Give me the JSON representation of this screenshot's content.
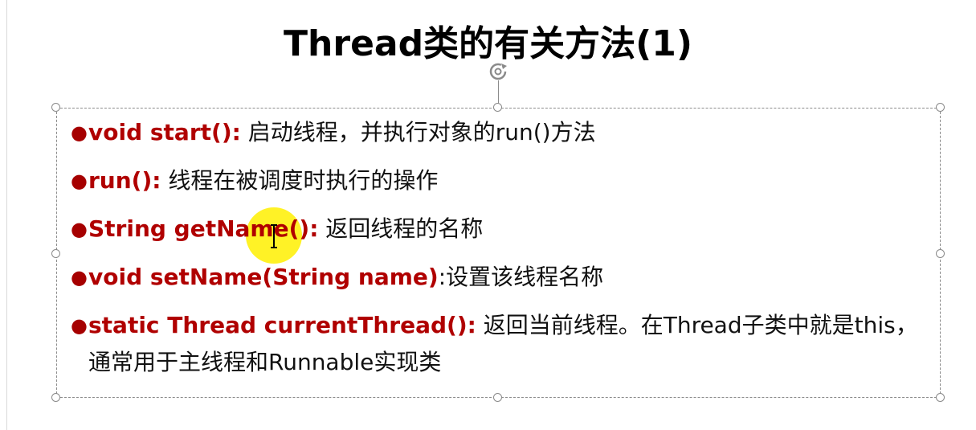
{
  "slide": {
    "title": "Thread类的有关方法(1)",
    "bullets": [
      {
        "method": "void start():",
        "description": " 启动线程，并执行对象的run()方法"
      },
      {
        "method": "run():",
        "description": " 线程在被调度时执行的操作"
      },
      {
        "method": "String getName():",
        "description": " 返回线程的名称"
      },
      {
        "method": "void setName(String name)",
        "description": ":设置该线程名称"
      },
      {
        "method": "static Thread currentThread():",
        "description": " 返回当前线程。在Thread子类中就是this，通常用于主线程和Runnable实现类"
      }
    ]
  },
  "colors": {
    "method_text": "#b00000",
    "bullet": "#a60000",
    "body_text": "#111111",
    "cursor_highlight": "#fff000",
    "selection_border": "#8c8c8c"
  },
  "icons": {
    "rotate_handle": "rotate-icon",
    "text_cursor": "ibeam-cursor-icon",
    "bullet": "bullet-dot-icon"
  }
}
